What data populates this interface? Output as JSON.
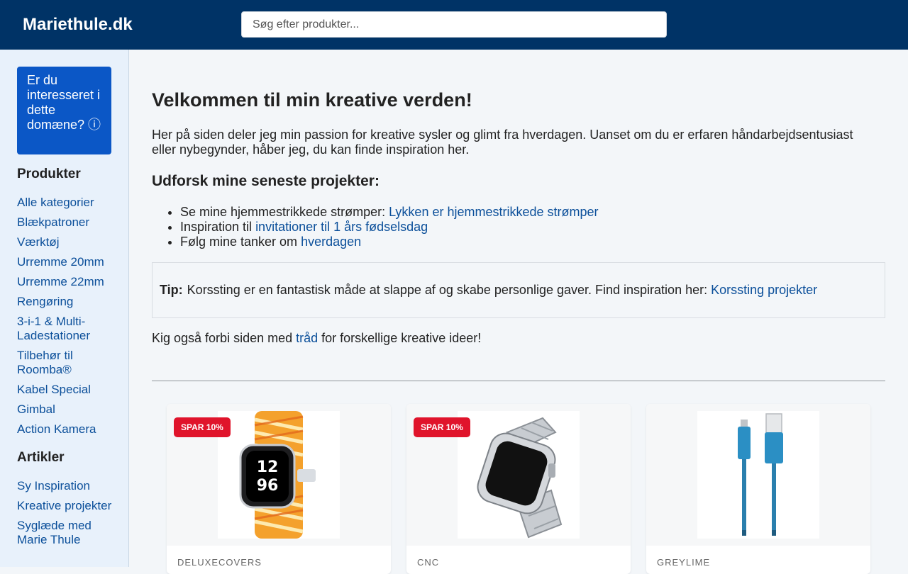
{
  "header": {
    "logo": "Mariethule.dk",
    "search_placeholder": "Søg efter produkter..."
  },
  "sidebar": {
    "domain_box": "Er du interesseret i dette domæne? ⓘ",
    "products_heading": "Produkter",
    "products": [
      "Alle kategorier",
      "Blækpatroner",
      "Værktøj",
      "Urremme 20mm",
      "Urremme 22mm",
      "Rengøring",
      "3-i-1 & Multi-Ladestationer",
      "Tilbehør til Roomba®",
      "Kabel Special",
      "Gimbal",
      "Action Kamera"
    ],
    "articles_heading": "Artikler",
    "articles": [
      "Sy Inspiration",
      "Kreative projekter",
      "Syglæde med Marie Thule"
    ]
  },
  "main": {
    "title": "Velkommen til min kreative verden!",
    "intro": "Her på siden deler jeg min passion for kreative sysler og glimt fra hverdagen. Uanset om du er erfaren håndarbejdsentusiast eller nybegynder, håber jeg, du kan finde inspiration her.",
    "subtitle": "Udforsk mine seneste projekter:",
    "projects": [
      {
        "text": "Se mine hjemmestrikkede strømper: ",
        "link": "Lykken er hjemmestrikkede strømper"
      },
      {
        "text": "Inspiration til ",
        "link": "invitationer til 1 års fødselsdag"
      },
      {
        "text": "Følg mine tanker om ",
        "link": "hverdagen"
      }
    ],
    "tip_label": "Tip:",
    "tip_text": "Korssting er en fantastisk måde at slappe af og skabe personlige gaver. Find inspiration her:",
    "tip_link": "Korssting projekter",
    "visit_before": "Kig også forbi siden med ",
    "visit_link": "tråd",
    "visit_after": " for forskellige kreative ideer!"
  },
  "products": [
    {
      "badge": "SPAR 10%",
      "brand": "DELUXECOVERS",
      "image": "braided-watch-band-orange-yellow"
    },
    {
      "badge": "SPAR 10%",
      "brand": "CNC",
      "image": "steel-link-watch-band-silver"
    },
    {
      "badge": "",
      "brand": "GREYLIME",
      "image": "usb-cable-blue-braided"
    }
  ]
}
